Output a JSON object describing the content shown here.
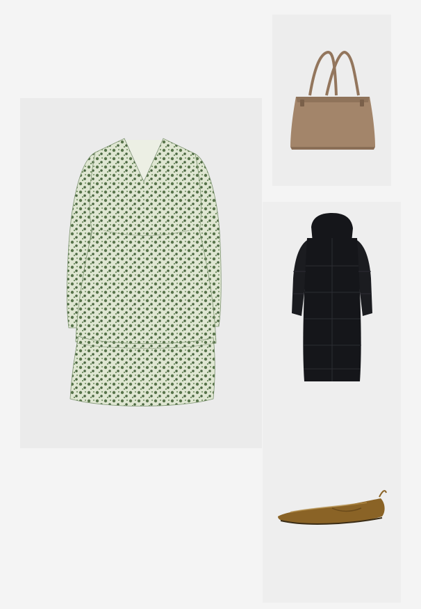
{
  "colors": {
    "page_background": "#f4f4f4",
    "tile_background": "#ececec",
    "dress_base": "#dfe6d2",
    "dress_print": "#58744b",
    "bag": "#a3856a",
    "coat": "#15161a",
    "flat": "#8a6326"
  },
  "items": [
    {
      "icon": "floral-dress-icon",
      "kind": "product-photo"
    },
    {
      "icon": "suede-tote-bag-icon",
      "kind": "product-photo"
    },
    {
      "icon": "puffer-coat-icon",
      "kind": "product-photo"
    },
    {
      "icon": "metallic-ballet-flat-icon",
      "kind": "product-photo"
    }
  ]
}
